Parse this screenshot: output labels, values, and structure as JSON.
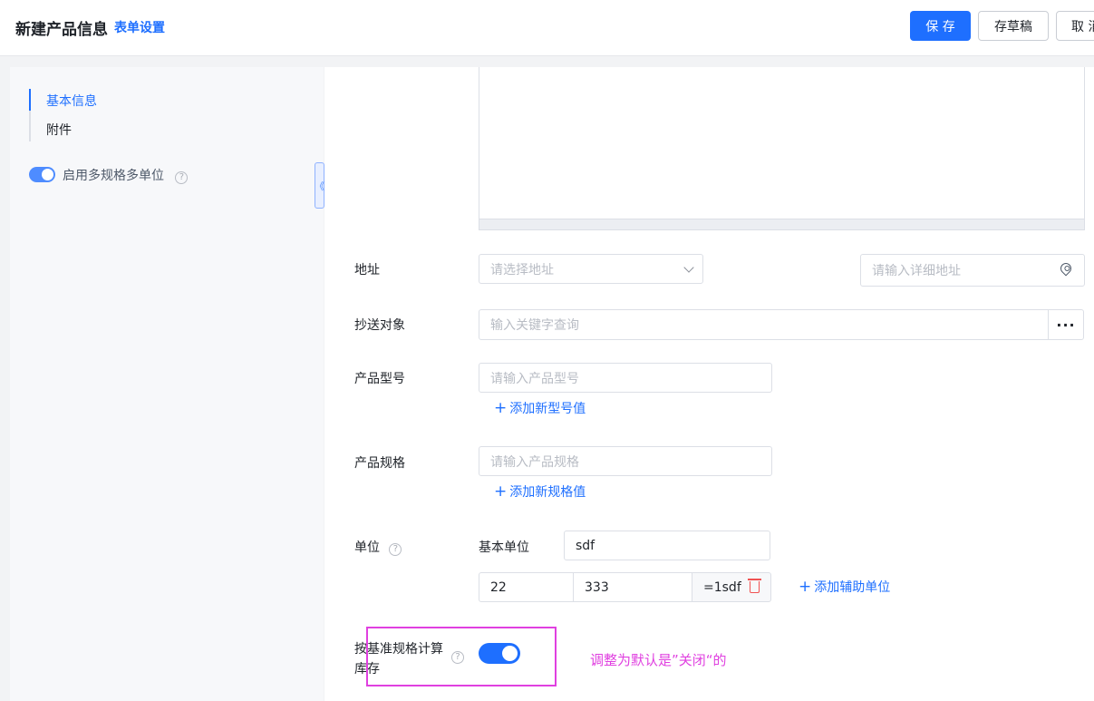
{
  "header": {
    "title": "新建产品信息",
    "form_settings": "表单设置",
    "save_label": "保 存",
    "draft_label": "存草稿",
    "cancel_label": "取 消"
  },
  "sidebar": {
    "nav": [
      {
        "label": "基本信息",
        "active": true
      },
      {
        "label": "附件",
        "active": false
      }
    ],
    "multi_spec_toggle_label": "启用多规格多单位",
    "multi_spec_enabled": true,
    "collapse_glyph": "《"
  },
  "form": {
    "address": {
      "label": "地址",
      "select_placeholder": "请选择地址",
      "detail_placeholder": "请输入详细地址"
    },
    "cc": {
      "label": "抄送对象",
      "placeholder": "输入关键字查询",
      "more": "···"
    },
    "model": {
      "label": "产品型号",
      "placeholder": "请输入产品型号",
      "add_label": "添加新型号值"
    },
    "spec": {
      "label": "产品规格",
      "placeholder": "请输入产品规格",
      "add_label": "添加新规格值"
    },
    "unit": {
      "label": "单位",
      "base_unit_label": "基本单位",
      "base_unit_value": "sdf",
      "aux_row": {
        "qty": "22",
        "name": "333",
        "ratio": "=1sdf"
      },
      "add_aux_label": "添加辅助单位"
    },
    "inventory": {
      "label": "按基准规格计算库存",
      "enabled": true
    }
  },
  "annotation": {
    "text": "调整为默认是”关闭“的",
    "color": "#e040e0"
  },
  "colors": {
    "accent": "#1e6fff",
    "danger": "#f05252",
    "annotation": "#e040e0"
  },
  "icons": [
    "help-icon",
    "chevron-down-icon",
    "location-pin-icon",
    "more-icon",
    "plus-icon",
    "trash-icon",
    "collapse-icon"
  ]
}
